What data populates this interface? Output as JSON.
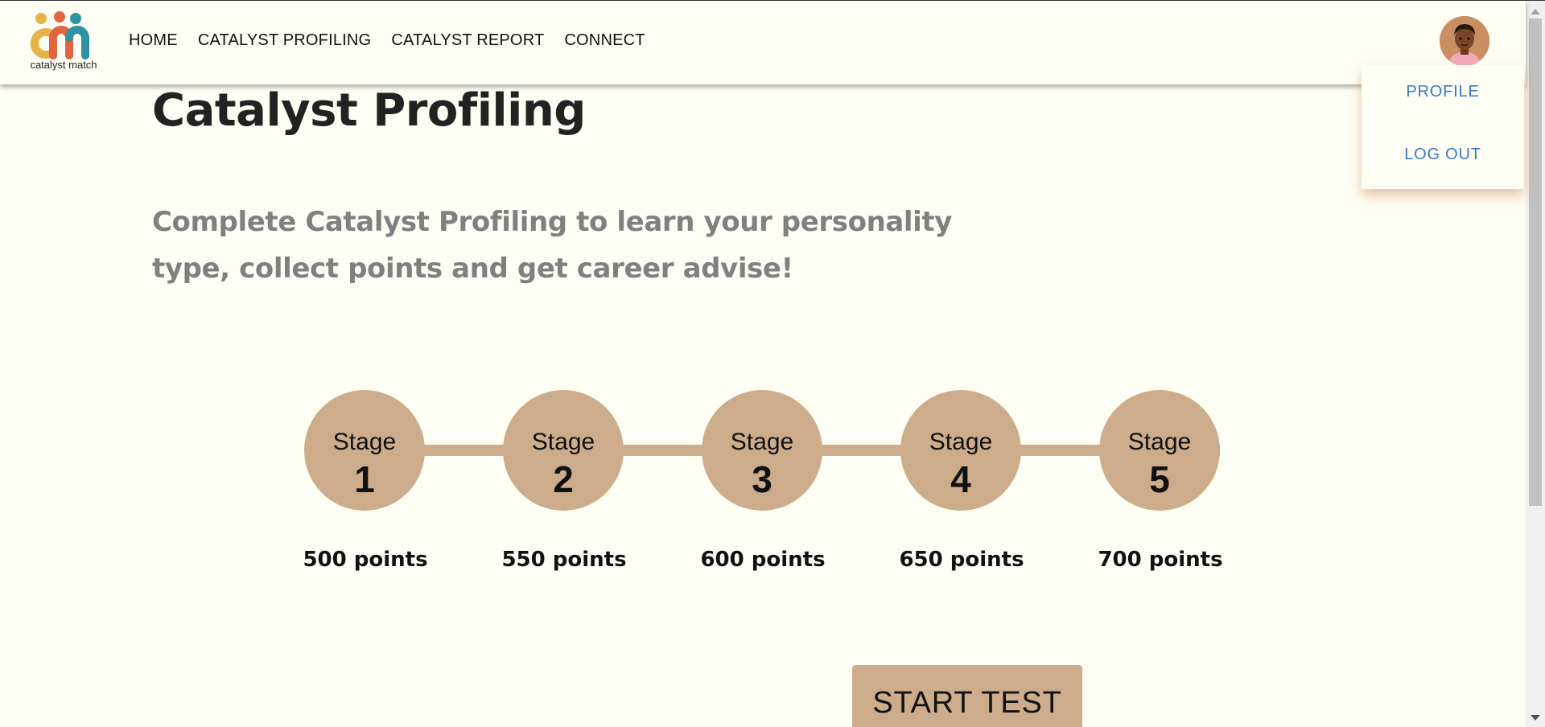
{
  "header": {
    "logo_text": "catalyst match",
    "nav": [
      {
        "label": "HOME"
      },
      {
        "label": "CATALYST PROFILING"
      },
      {
        "label": "CATALYST REPORT"
      },
      {
        "label": "CONNECT"
      }
    ],
    "avatar_icon": "user-avatar-icon"
  },
  "dropdown": {
    "profile_label": "PROFILE",
    "logout_label": "LOG OUT"
  },
  "main": {
    "title": "Catalyst Profiling",
    "subtitle": "Complete Catalyst Profiling to learn your personality type, collect points and get career advise!",
    "stages": [
      {
        "word": "Stage",
        "number": "1",
        "points": "500 points"
      },
      {
        "word": "Stage",
        "number": "2",
        "points": "550 points"
      },
      {
        "word": "Stage",
        "number": "3",
        "points": "600 points"
      },
      {
        "word": "Stage",
        "number": "4",
        "points": "650 points"
      },
      {
        "word": "Stage",
        "number": "5",
        "points": "700 points"
      }
    ],
    "start_label": "START TEST"
  },
  "colors": {
    "background": "#fefef4",
    "accent_tan": "#cdac8b",
    "link_blue": "#3a78c4",
    "subtitle_gray": "#808080",
    "logo_yellow": "#e7b24a",
    "logo_orange": "#e2653f",
    "logo_teal": "#2c93a1"
  }
}
